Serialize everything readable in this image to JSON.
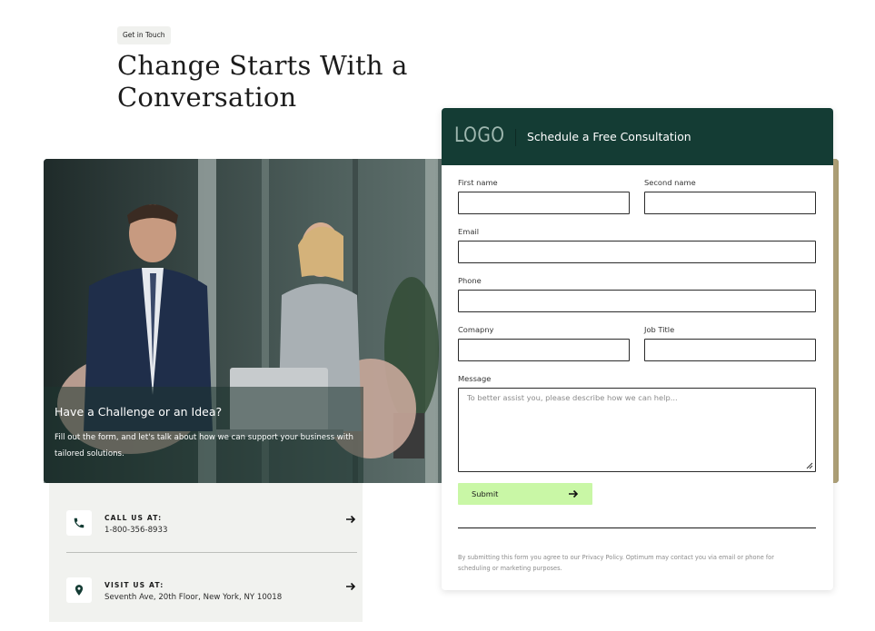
{
  "intro": {
    "tag": "Get in Touch",
    "headline_line1": "Change Starts With a",
    "headline_line2": "Conversation"
  },
  "photo_caption": {
    "title": "Have a Challenge or an Idea?",
    "text": "Fill out the form, and let's talk about how we can support your business with tailored solutions."
  },
  "contact": {
    "call": {
      "title": "CALL US AT:",
      "value": "1-800-356-8933",
      "icon": "phone-icon"
    },
    "visit": {
      "title": "VISIT US AT:",
      "value": "Seventh Ave, 20th Floor, New York, NY 10018",
      "icon": "location-pin-icon"
    }
  },
  "form": {
    "logo": "LOGO",
    "title": "Schedule a Free Consultation",
    "labels": {
      "first_name": "First name",
      "second_name": "Second name",
      "email": "Email",
      "phone": "Phone",
      "company": "Comapny",
      "job_title": "Job Title",
      "message": "Message"
    },
    "message_placeholder": "To better assist you, please describe how we can help...",
    "submit_label": "Submit",
    "disclaimer": "By submitting this form you agree to our Privacy Policy. Optimum may contact you via email or phone for scheduling or marketing purposes."
  },
  "colors": {
    "header_bg": "#143c34",
    "submit_bg": "#c9f7a6",
    "card_bg": "#f1f2ef"
  }
}
